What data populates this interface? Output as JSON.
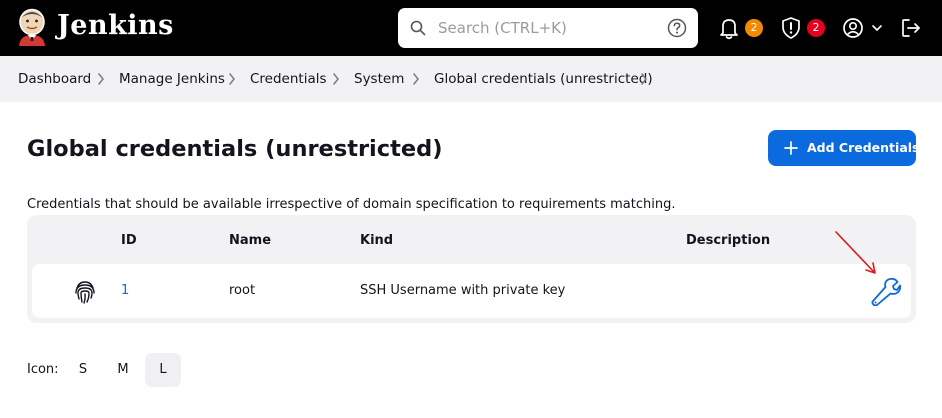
{
  "header": {
    "brand": "Jenkins",
    "search_placeholder": "Search (CTRL+K)",
    "notifications_count": "2",
    "security_count": "2",
    "colors": {
      "bg": "#000000",
      "notification_badge": "#f28a00",
      "security_badge": "#e6001f"
    }
  },
  "breadcrumb": [
    "Dashboard",
    "Manage Jenkins",
    "Credentials",
    "System",
    "Global credentials (unrestricted)"
  ],
  "page": {
    "title": "Global credentials (unrestricted)",
    "add_button_label": "Add Credentials",
    "description": "Credentials that should be available irrespective of domain specification to requirements matching.",
    "accent": "#0b6bde"
  },
  "table": {
    "headers": {
      "id": "ID",
      "name": "Name",
      "kind": "Kind",
      "description": "Description"
    },
    "rows": [
      {
        "icon": "fingerprint-icon",
        "id": "1",
        "name": "root",
        "kind": "SSH Username with private key",
        "description": "",
        "action_icon": "wrench-icon"
      }
    ]
  },
  "icon_size": {
    "label": "Icon:",
    "options": [
      "S",
      "M",
      "L"
    ],
    "selected": "L"
  }
}
